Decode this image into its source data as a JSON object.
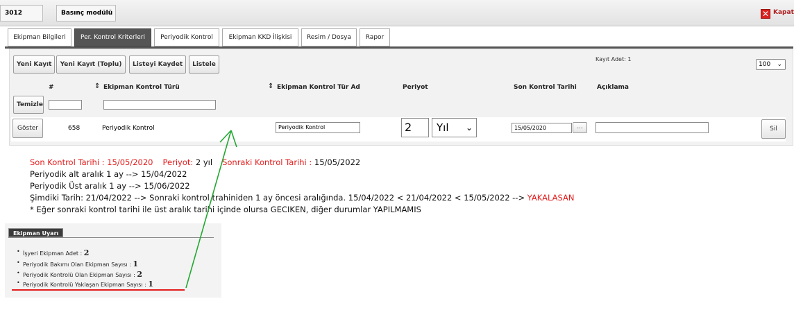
{
  "topbar": {
    "id": "3012",
    "module": "Basınç modülü",
    "close_label": "Kapat"
  },
  "tabs": [
    {
      "label": "Ekipman Bilgileri",
      "active": false
    },
    {
      "label": "Per. Kontrol Kriterleri",
      "active": true
    },
    {
      "label": "Periyodik Kontrol",
      "active": false
    },
    {
      "label": "Ekipman KKD İlişkisi",
      "active": false
    },
    {
      "label": "Resim / Dosya",
      "active": false
    },
    {
      "label": "Rapor",
      "active": false
    }
  ],
  "toolbar": {
    "new_record": "Yeni Kayıt",
    "new_record_bulk": "Yeni Kayıt (Toplu)",
    "save_list": "Listeyi Kaydet",
    "list": "Listele",
    "record_count": "Kayıt Adet: 1",
    "page_size": "100"
  },
  "table": {
    "columns": {
      "no": "#",
      "type": "Ekipman Kontrol Türü",
      "type_name": "Ekipman Kontrol Tür Ad",
      "period": "Periyot",
      "last_date": "Son Kontrol Tarihi",
      "note": "Açıklama"
    },
    "clear_button": "Temizle",
    "row": {
      "show_button": "Göster",
      "no": "658",
      "type": "Periyodik Kontrol",
      "type_name": "Periyodik Kontrol",
      "period_value": "2",
      "period_unit": "Yıl",
      "last_date": "15/05/2020",
      "date_picker": "...",
      "note": "",
      "delete_button": "Sil"
    }
  },
  "notes": {
    "line1_a": "Son Kontrol Tarihi : 15/05/2020",
    "line1_b": "Periyot:",
    "line1_c": " 2 yıl",
    "line1_d": "Sonraki Kontrol Tarihi :",
    "line1_e": " 15/05/2022",
    "line2": "Periyodik alt aralık 1 ay -->  15/04/2022",
    "line3": "Periyodik Üst aralık 1 ay --> 15/06/2022",
    "line4_a": "Şimdiki Tarih: 21/04/2022 --> Sonraki kontrol trahiniden 1 ay öncesi aralığında. 15/04/2022 < 21/04/2022 < 15/05/2022 --> ",
    "line4_b": "YAKALASAN",
    "line5": "* Eğer sonraki kontrol tarihi ile üst aralık tarihi içinde olursa  GECIKEN,  diğer durumlar YAPILMAMIS"
  },
  "warning_panel": {
    "title": "Ekipman Uyarı",
    "items": [
      {
        "label": "İşyeri Ekipman Adet :",
        "value": "2"
      },
      {
        "label": "Periyodik Bakımı Olan Ekipman Sayısı :",
        "value": "1"
      },
      {
        "label": "Periyodik Kontrolü Olan Ekipman Sayısı :",
        "value": "2"
      },
      {
        "label": "Periyodik Kontrolü Yaklaşan Ekipman Sayısı :",
        "value": "1"
      }
    ]
  },
  "colors": {
    "arrow": "#22a832",
    "highlight_red": "#e31d1d",
    "active_tab": "#555555"
  }
}
